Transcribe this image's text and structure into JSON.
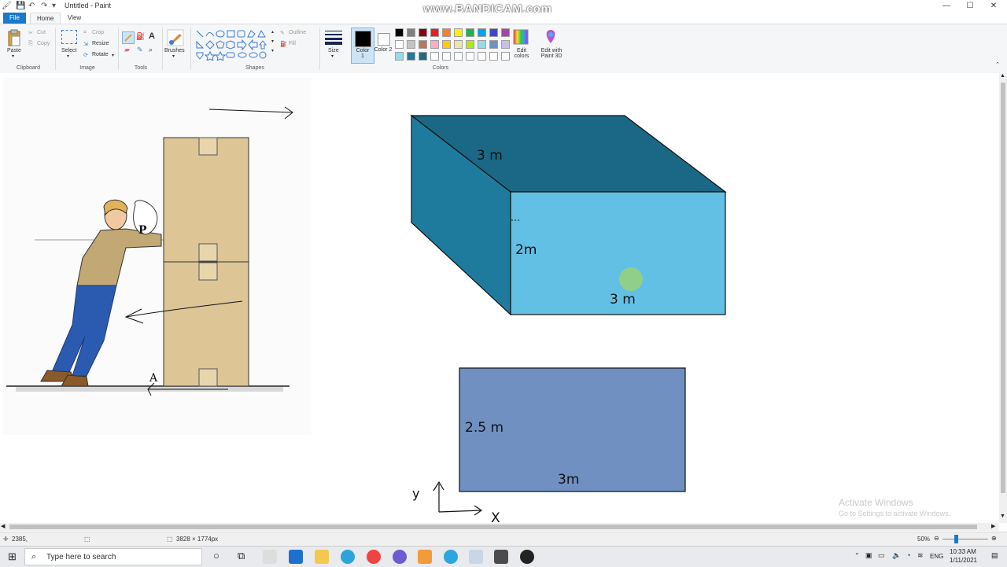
{
  "window": {
    "title": "Untitled - Paint",
    "watermark": "www.BANDICAM.com",
    "minimize": "—",
    "maximize": "☐",
    "close": "✕"
  },
  "tabs": [
    {
      "label": "File"
    },
    {
      "label": "Home"
    },
    {
      "label": "View"
    }
  ],
  "ribbon": {
    "clipboard": {
      "paste": "Paste",
      "cut": "Cut",
      "copy": "Copy",
      "group": "Clipboard"
    },
    "image": {
      "select": "Select",
      "crop": "Crop",
      "resize": "Resize",
      "rotate": "Rotate",
      "group": "Image"
    },
    "tools": {
      "group": "Tools"
    },
    "brushes": {
      "label": "Brushes"
    },
    "shapes": {
      "outline": "Outline",
      "fill": "Fill",
      "group": "Shapes"
    },
    "size": {
      "label": "Size"
    },
    "color1": {
      "label": "Color 1"
    },
    "color2": {
      "label": "Color 2"
    },
    "colors_group": "Colors",
    "edit_colors": "Edit colors",
    "edit_paint3d": "Edit with Paint 3D",
    "palette_row1": [
      "#000000",
      "#7f7f7f",
      "#880015",
      "#ed1c24",
      "#ff7f27",
      "#fff200",
      "#22b14c",
      "#00a2e8",
      "#3f48cc",
      "#a349a4"
    ],
    "palette_row2": [
      "#ffffff",
      "#c3c3c3",
      "#b97a57",
      "#ffaec9",
      "#ffc90e",
      "#efe4b0",
      "#b5e61d",
      "#99d9ea",
      "#7092be",
      "#c8bfe7"
    ],
    "palette_row3": [
      "#99d9ea",
      "#1f7a9c",
      "#196f82",
      "#ffffff",
      "#ffffff",
      "#ffffff",
      "#ffffff",
      "#ffffff",
      "#ffffff",
      "#ffffff"
    ],
    "color1_value": "#000000",
    "color2_value": "#ffffff"
  },
  "canvas": {
    "box_labels": {
      "depth": "3 m",
      "height": "2m",
      "width": "3 m"
    },
    "rect_labels": {
      "height": "2.5 m",
      "width": "3m"
    },
    "figure_labels": {
      "p": "P",
      "a": "A"
    },
    "axis_labels": {
      "y": "y",
      "x": "X"
    },
    "colors": {
      "box_top": "#1b6886",
      "box_side": "#1f7b9e",
      "box_front": "#63c0e5",
      "rect": "#6f90c1",
      "cursor_dot": "#9fd46a"
    }
  },
  "status": {
    "cursor": "2385,",
    "size": "3828 × 1774px",
    "zoom": "50%"
  },
  "watermark_windows": {
    "line1": "Activate Windows",
    "line2": "Go to Settings to activate Windows."
  },
  "taskbar": {
    "search_placeholder": "Type here to search",
    "language": "ENG",
    "time": "10:33 AM",
    "date": "1/11/2021"
  }
}
